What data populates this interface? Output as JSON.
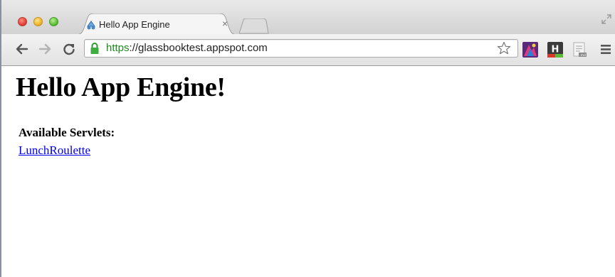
{
  "tab": {
    "title": "Hello App Engine",
    "close_label": "×"
  },
  "address_bar": {
    "scheme": "https",
    "rest": "://glassbooktest.appspot.com"
  },
  "page": {
    "heading": "Hello App Engine!",
    "servlets_label": "Available Servlets:",
    "links": [
      "LunchRoulette"
    ]
  },
  "colors": {
    "secure_scheme": "#1e8a1e",
    "link": "#0000ee"
  },
  "icons": {
    "back": "back-arrow-icon",
    "forward": "forward-arrow-icon",
    "reload": "reload-icon",
    "lock": "lock-icon",
    "bookmark": "star-icon",
    "extensions": [
      "extension-icon",
      "h-extension-icon",
      "markdown-icon"
    ],
    "menu": "menu-icon",
    "fullscreen": "fullscreen-icon"
  }
}
